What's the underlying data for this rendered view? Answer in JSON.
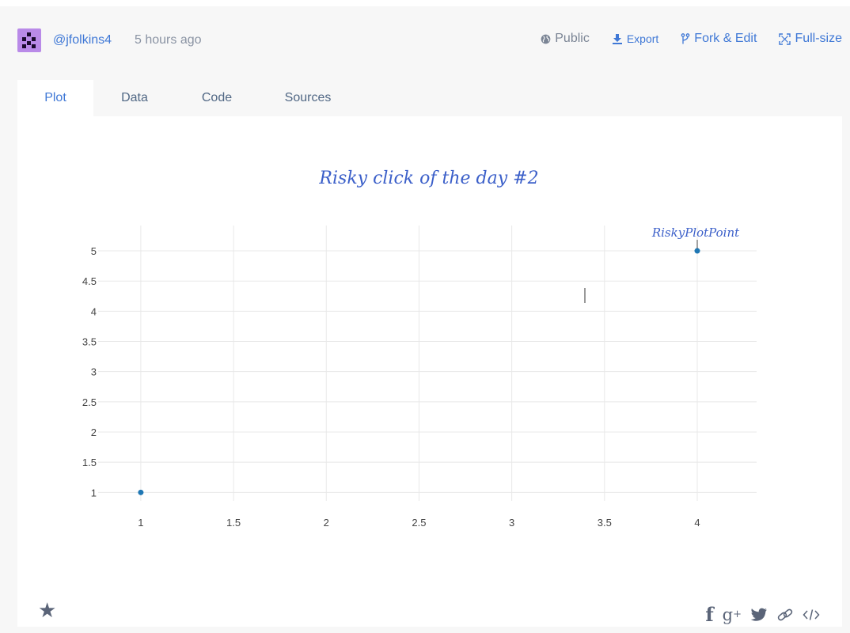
{
  "header": {
    "username": "@jfolkins4",
    "time_ago": "5 hours ago",
    "visibility_label": "Public",
    "export_label": "Export",
    "fork_label": "Fork & Edit",
    "fullsize_label": "Full-size"
  },
  "tabs": [
    {
      "label": "Plot",
      "active": true
    },
    {
      "label": "Data",
      "active": false
    },
    {
      "label": "Code",
      "active": false
    },
    {
      "label": "Sources",
      "active": false
    }
  ],
  "icons": {
    "visibility": "globe-icon",
    "export": "download-icon",
    "fork": "fork-icon",
    "fullsize": "expand-icon",
    "star": "star-icon",
    "facebook": "facebook-icon",
    "google_plus": "google-plus-icon",
    "twitter": "twitter-icon",
    "link": "link-icon",
    "embed": "embed-code-icon"
  },
  "colors": {
    "accent": "#3f78d6",
    "marker": "#1f77b4",
    "title": "#3b5fc9",
    "avatar": "#b98ae8"
  },
  "chart_data": {
    "type": "scatter",
    "title": "Risky click of the day #2",
    "x": [
      1,
      4
    ],
    "y": [
      1,
      5
    ],
    "xlim": [
      0.77,
      4.32
    ],
    "ylim": [
      0.86,
      5.42
    ],
    "x_ticks": [
      1,
      1.5,
      2,
      2.5,
      3,
      3.5,
      4
    ],
    "x_tick_labels": [
      "1",
      "1.5",
      "2",
      "2.5",
      "3",
      "3.5",
      "4"
    ],
    "y_ticks": [
      1,
      1.5,
      2,
      2.5,
      3,
      3.5,
      4,
      4.5,
      5
    ],
    "y_tick_labels": [
      "1",
      "1.5",
      "2",
      "2.5",
      "3",
      "3.5",
      "4",
      "4.5",
      "5"
    ],
    "grid": true,
    "annotations": [
      {
        "text": "RiskyPlotPoint",
        "x": 4,
        "y": 5
      }
    ]
  }
}
